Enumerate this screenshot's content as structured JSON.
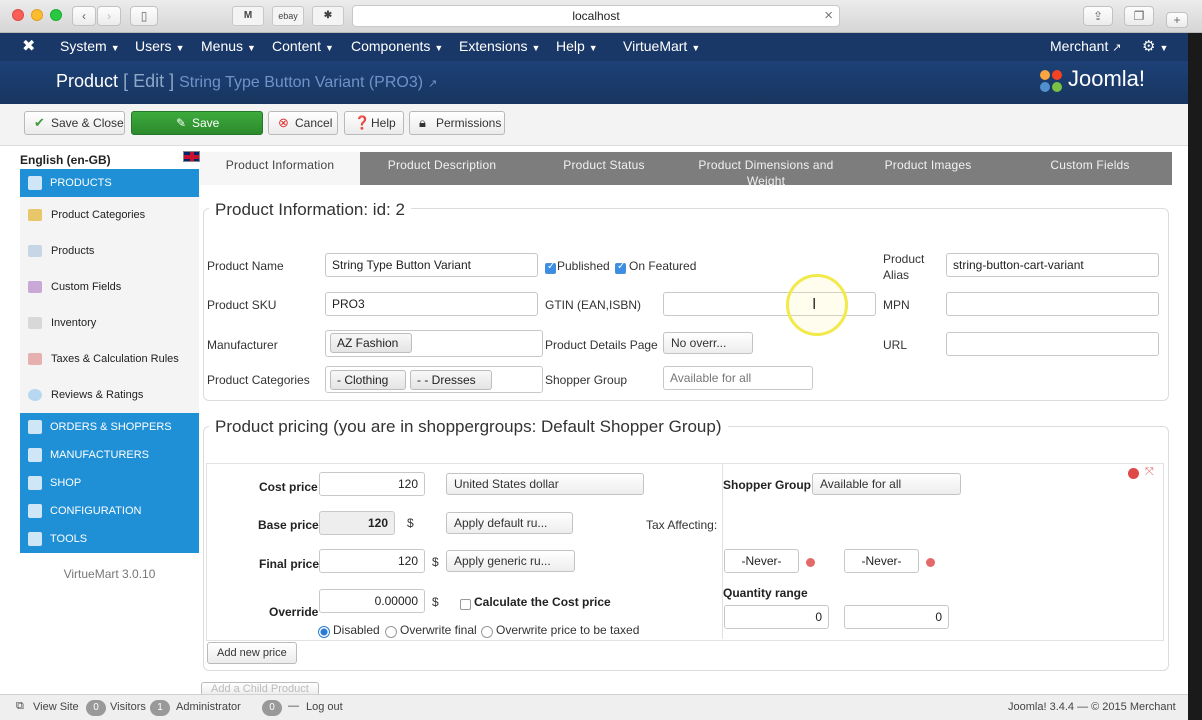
{
  "browser": {
    "url": "localhost",
    "fav1": "M",
    "fav2": "ebay"
  },
  "nav": {
    "items": [
      "System",
      "Users",
      "Menus",
      "Content",
      "Components",
      "Extensions",
      "Help",
      "VirtueMart"
    ],
    "merchant": "Merchant"
  },
  "header": {
    "title_main": "Product",
    "title_edit": "[ Edit ]",
    "title_item": "String Type Button Variant (PRO3)",
    "logo": "Joomla!"
  },
  "toolbar": {
    "save_close": "Save & Close",
    "save": "Save",
    "cancel": "Cancel",
    "help": "Help",
    "permissions": "Permissions"
  },
  "sidebar": {
    "language": "English (en-GB)",
    "products_head": "PRODUCTS",
    "items": [
      "Product Categories",
      "Products",
      "Custom Fields",
      "Inventory",
      "Taxes & Calculation Rules",
      "Reviews & Ratings"
    ],
    "sections": [
      "ORDERS & SHOPPERS",
      "MANUFACTURERS",
      "SHOP",
      "CONFIGURATION",
      "TOOLS"
    ],
    "version": "VirtueMart 3.0.10"
  },
  "tabs": [
    "Product Information",
    "Product Description",
    "Product Status",
    "Product Dimensions and Weight",
    "Product Images",
    "Custom Fields"
  ],
  "info": {
    "legend": "Product Information: id: 2",
    "product_name_label": "Product Name",
    "product_name": "String Type Button Variant",
    "published": "Published",
    "on_featured": "On Featured",
    "alias_label": "Product Alias",
    "alias": "string-button-cart-variant",
    "sku_label": "Product SKU",
    "sku": "PRO3",
    "gtin_label": "GTIN (EAN,ISBN)",
    "mpn_label": "MPN",
    "manufacturer_label": "Manufacturer",
    "manufacturer": "AZ Fashion",
    "details_label": "Product Details Page",
    "details_value": "No overr...",
    "url_label": "URL",
    "categories_label": "Product Categories",
    "cat1": "- Clothing",
    "cat2": "- - Dresses",
    "shopper_label": "Shopper Group",
    "shopper_placeholder": "Available for all"
  },
  "pricing": {
    "legend": "Product pricing (you are in shoppergroups: Default Shopper Group)",
    "cost_label": "Cost price",
    "cost": "120",
    "currency": "United States dollar",
    "shopper_group_label": "Shopper Group",
    "shopper_group": "Available for all",
    "base_label": "Base price",
    "base": "120",
    "dollar": "$",
    "apply_default": "Apply default ru...",
    "tax_affecting": "Tax Affecting:",
    "final_label": "Final price",
    "final": "120",
    "apply_generic": "Apply generic ru...",
    "never1": "-Never-",
    "never2": "-Never-",
    "override_label": "Override",
    "override": "0.00000",
    "calc_cost": "Calculate the Cost price",
    "quantity_range": "Quantity range",
    "qty_from": "0",
    "qty_to": "0",
    "radio_disabled": "Disabled",
    "radio_overwrite_final": "Overwrite final",
    "radio_overwrite_tax": "Overwrite price to be taxed",
    "add_price": "Add new price",
    "add_child": "Add a Child Product"
  },
  "status": {
    "view_site": "View Site",
    "visitors_count": "0",
    "visitors": "Visitors",
    "admin_count": "1",
    "admin": "Administrator",
    "logout_count": "0",
    "logout": "Log out",
    "copyright": "Joomla! 3.4.4 — © 2015 Merchant"
  }
}
